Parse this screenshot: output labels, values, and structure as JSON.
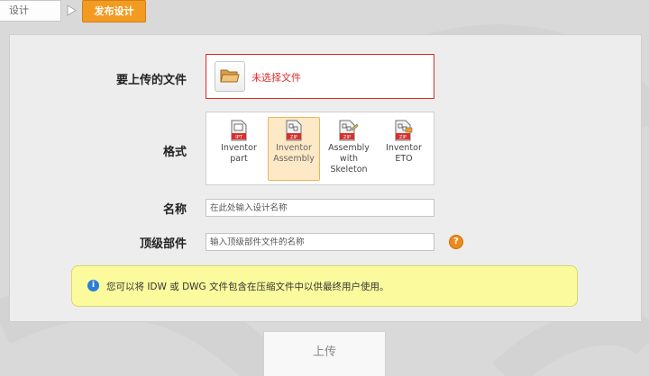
{
  "steps": [
    {
      "label": "设计"
    },
    {
      "label": "发布设计"
    }
  ],
  "form": {
    "file_label": "要上传的文件",
    "file_status": "未选择文件",
    "format_label": "格式",
    "formats": [
      {
        "tag": "IPT",
        "name": "Inventor\npart",
        "selected": false
      },
      {
        "tag": "ZIP",
        "name": "Inventor\nAssembly",
        "selected": true
      },
      {
        "tag": "ZIP",
        "name": "Assembly\nwith\nSkeleton",
        "selected": false
      },
      {
        "tag": "ZIP",
        "name": "Inventor\nETO",
        "selected": false
      }
    ],
    "name_label": "名称",
    "name_placeholder": "在此处输入设计名称",
    "top_label": "顶级部件",
    "top_placeholder": "输入顶级部件文件的名称",
    "help_symbol": "?"
  },
  "note": {
    "icon": "i",
    "text": "您可以将 IDW 或 DWG 文件包含在压缩文件中以供最终用户使用。"
  },
  "upload_label": "上传",
  "colors": {
    "accent": "#f29b23",
    "error": "#e02b2b",
    "note_bg": "#fbfb9e",
    "info": "#2a7fd6",
    "selected_bg": "#fde9c6"
  }
}
